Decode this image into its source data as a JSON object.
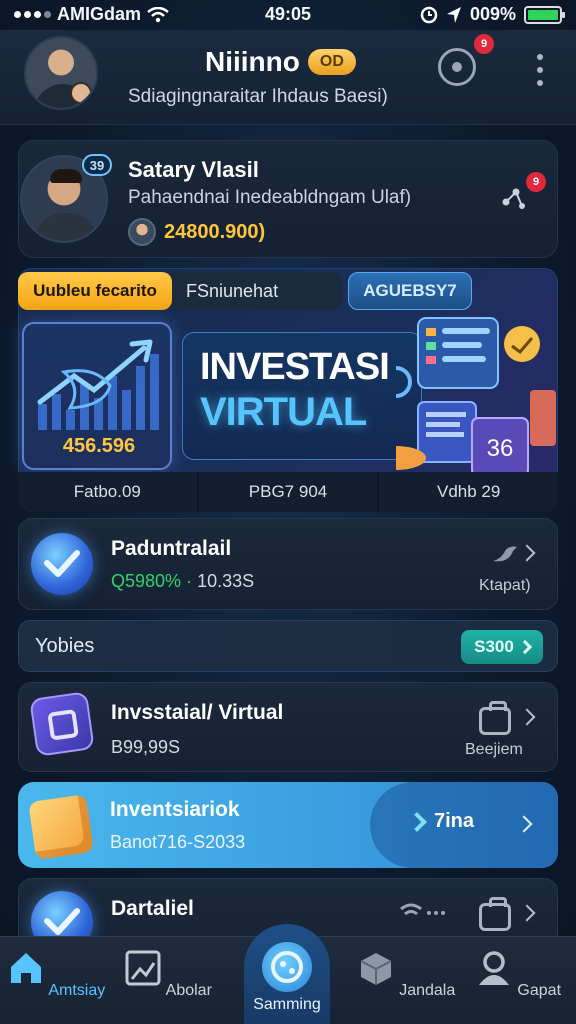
{
  "status_bar": {
    "carrier": "AMIGdam",
    "time": "49:05",
    "battery": "009%"
  },
  "header": {
    "name": "Niiinno",
    "coin_label": "OD",
    "subtitle": "Sdiagingnaraitar Ihdaus Baesi)",
    "chat_badge": "9"
  },
  "profile": {
    "level_badge": "39",
    "name": "Satary Vlasil",
    "subtitle": "Pahaendnai Inedeabldngam Ulaf)",
    "balance": "24800.900)",
    "share_badge": "9"
  },
  "tabs": [
    {
      "label": "Uubleu fecarito"
    },
    {
      "label": "FSniunehat"
    },
    {
      "label": "AGUEBSY7"
    }
  ],
  "banner": {
    "chart_value": "456.596",
    "title_line1": "INVESTASI",
    "title_line2": "VIRTUAL",
    "card_number": "36"
  },
  "stats": [
    "Fatbo.09",
    "PBG7 904",
    "Vdhb 29"
  ],
  "cards": [
    {
      "title": "Paduntralail",
      "change": "Q5980% ·",
      "value": "10.33S",
      "side_label": "Ktapat)"
    },
    {
      "title": "Invsstaial/ Virtual",
      "value": "B99,99S",
      "side_label": "Beejiem"
    }
  ],
  "yobies": {
    "label": "Yobies",
    "button": "S300"
  },
  "highlight": {
    "title": "Inventsiariok",
    "subtitle": "Banot716-S2033",
    "cta": "7ina"
  },
  "last_card": {
    "title": "Dartaliel"
  },
  "bottom_nav": [
    "Amtsiay",
    "Abolar",
    "Samming",
    "Jandala",
    "Gapat"
  ],
  "colors": {
    "accent": "#55c4ff",
    "gold": "#ffc53d",
    "success": "#31d36a",
    "alert": "#e0293c"
  }
}
